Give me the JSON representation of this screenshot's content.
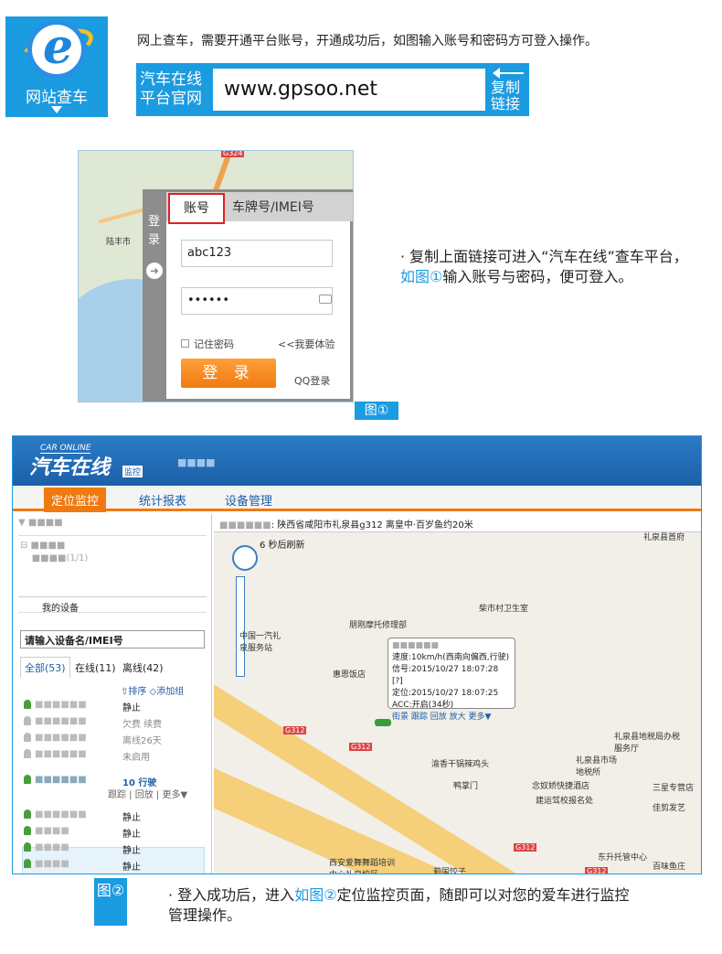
{
  "banner": {
    "logo_label": "网站查车",
    "intro": "网上查车，需要开通平台账号，开通成功后，如图输入账号和密码方可登入操作。",
    "platform_label": "汽车在线平台官网",
    "url": "www.gpsoo.net",
    "copy_link": "复制链接"
  },
  "login": {
    "map_road": "G324",
    "map_city": "陆丰市",
    "side_label": "登录",
    "tab_account": "账号",
    "tab_plate": "车牌号/IMEI号",
    "account_value": "abc123",
    "password_value": "••••••",
    "remember_label": "记住密码",
    "try_link": "<<我要体验",
    "login_button": "登 录",
    "qq_login": "QQ登录",
    "figure_label": "图①",
    "desc_a": "· 复制上面链接可进入“汽车在线”查车平台，",
    "desc_hl": "如图①",
    "desc_b": "输入账号与密码，便可登入。"
  },
  "monitor": {
    "logo_sub": "CAR ONLINE",
    "logo_text": "汽车在线",
    "logo_badge": "监控",
    "nav": [
      "定位监控",
      "统计报表",
      "设备管理"
    ],
    "my_devices": "我的设备",
    "search_placeholder": "请输入设备名/IMEI号",
    "tab_all": "全部(53)",
    "tab_online": "在线(11)",
    "tab_offline": "离线(42)",
    "sort": "⇧排序 ◇添加组",
    "devices": [
      {
        "status": "静止"
      },
      {
        "status": "欠费 续费"
      },
      {
        "status": "离线26天"
      },
      {
        "status": "未启用"
      },
      {
        "status": "10 行驶"
      },
      {
        "status": "静止"
      },
      {
        "status": "静止"
      },
      {
        "status": "静止"
      },
      {
        "status": "静止"
      }
    ],
    "active_actions": "跟踪 | 回放 | 更多▼",
    "address": ": 陕西省咸阳市礼泉县g312 离皇中·百岁鱼约20米",
    "refresh": "6 秒后刷新",
    "info": {
      "speed": "速度:10km/h(西南向偏西,行驶)",
      "signal": "信号:2015/10/27 18:07:28 [?]",
      "position": "定位:2015/10/27 18:07:25",
      "acc": "ACC:开启(34秒)",
      "links": "街景 跟踪 回放 放大 更多▼"
    },
    "pois": [
      "柴市村卫生室",
      "朋刚摩托修理部",
      "中国一汽礼泉服务站",
      "惠恩饭店",
      "渝香干锅辣鸡头",
      "鸭掌门",
      "念奴娇快捷酒店",
      "礼泉县地税局办税服务厅",
      "礼泉县市场地税所",
      "三星专营店",
      "建运驾校报名处",
      "佳剪发艺",
      "东升托管中心",
      "西安爱舞舞蹈培训中心礼泉校区",
      "莉国饺子",
      "百味鱼庄",
      "礼泉县首府"
    ],
    "road_labels": [
      "G312",
      "G312",
      "G312",
      "G312"
    ]
  },
  "fig2": {
    "label": "图②",
    "desc_a": "· 登入成功后，进入",
    "desc_hl": "如图②",
    "desc_b": "定位监控页面，随即可以对您的爱车进行监控管理操作。"
  }
}
